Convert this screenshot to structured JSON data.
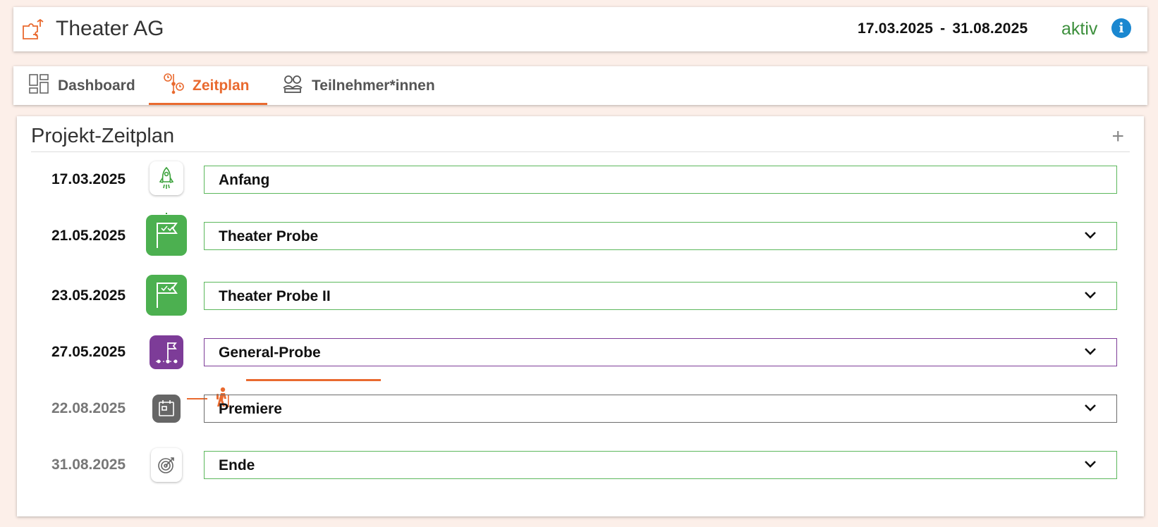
{
  "header": {
    "title": "Theater AG",
    "start_date": "17.03.2025",
    "separator": "-",
    "end_date": "31.08.2025",
    "status": "aktiv",
    "info_label": "i",
    "logo_icon": "puzzle-arrows-icon"
  },
  "tabs": [
    {
      "label": "Dashboard",
      "icon": "dashboard-icon",
      "active": false
    },
    {
      "label": "Zeitplan",
      "icon": "timeline-icon",
      "active": true
    },
    {
      "label": "Teilnehmer*innen",
      "icon": "participants-icon",
      "active": false
    }
  ],
  "main": {
    "title": "Projekt-Zeitplan",
    "add_label": "+",
    "milestones": [
      {
        "date": "17.03.2025",
        "label": "Anfang",
        "icon": "rocket-icon",
        "expandable": false
      },
      {
        "date": "21.05.2025",
        "label": "Theater Probe",
        "icon": "flag-check-icon",
        "expandable": true
      },
      {
        "date": "23.05.2025",
        "label": "Theater Probe II",
        "icon": "flag-check-icon",
        "expandable": true
      },
      {
        "date": "27.05.2025",
        "label": "General-Probe",
        "icon": "flag-path-icon",
        "expandable": true
      },
      {
        "date": "22.08.2025",
        "label": "Premiere",
        "icon": "calendar-icon",
        "expandable": true
      },
      {
        "date": "31.08.2025",
        "label": "Ende",
        "icon": "target-icon",
        "expandable": true
      }
    ],
    "today_marker_icon": "hiker-icon"
  },
  "colors": {
    "accent": "#e96a2f",
    "done_green": "#5cb85c",
    "active_status": "#3c8f3c",
    "general_probe_purple": "#7d3c98",
    "premiere_gray": "#6b6b6b",
    "info_blue": "#1a87d0",
    "page_bg": "#fcefe9"
  }
}
